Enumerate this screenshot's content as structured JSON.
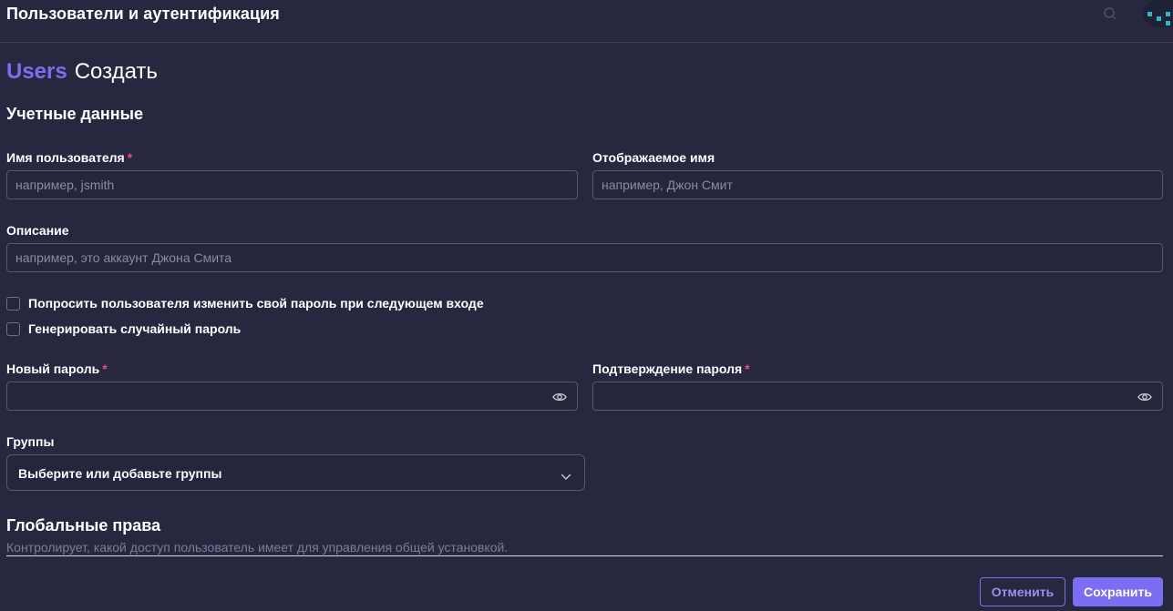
{
  "header": {
    "title": "Пользователи и аутентификация",
    "search_icon": "search-icon",
    "avatar_icon": "pixel-avatar-icon"
  },
  "page": {
    "breadcrumb": "Users",
    "title": "Создать"
  },
  "credentials": {
    "section_title": "Учетные данные",
    "username": {
      "label": "Имя пользователя",
      "required": "*",
      "placeholder": "например, jsmith",
      "value": ""
    },
    "display_name": {
      "label": "Отображаемое имя",
      "placeholder": "например, Джон Смит",
      "value": ""
    },
    "description": {
      "label": "Описание",
      "placeholder": "например, это аккаунт Джона Смита",
      "value": ""
    },
    "checkboxes": [
      {
        "label": "Попросить пользователя изменить свой пароль при следующем входе",
        "checked": false
      },
      {
        "label": "Генерировать случайный пароль",
        "checked": false
      }
    ],
    "new_password": {
      "label": "Новый пароль",
      "required": "*",
      "value": "",
      "icon": "eye-icon"
    },
    "confirm_password": {
      "label": "Подтверждение пароля",
      "required": "*",
      "value": "",
      "icon": "eye-icon"
    },
    "groups": {
      "label": "Группы",
      "selected": "Выберите или добавьте группы",
      "icon": "chevron-down-icon"
    }
  },
  "global_permissions": {
    "title": "Глобальные права",
    "description": "Контролирует, какой доступ пользователь имеет для управления общей установкой."
  },
  "actions": {
    "cancel_label": "Отменить",
    "save_label": "Сохранить"
  },
  "colors": {
    "background": "#262840",
    "accent": "#7c6ef0",
    "required": "#ec4a8c",
    "border": "#55586f"
  }
}
